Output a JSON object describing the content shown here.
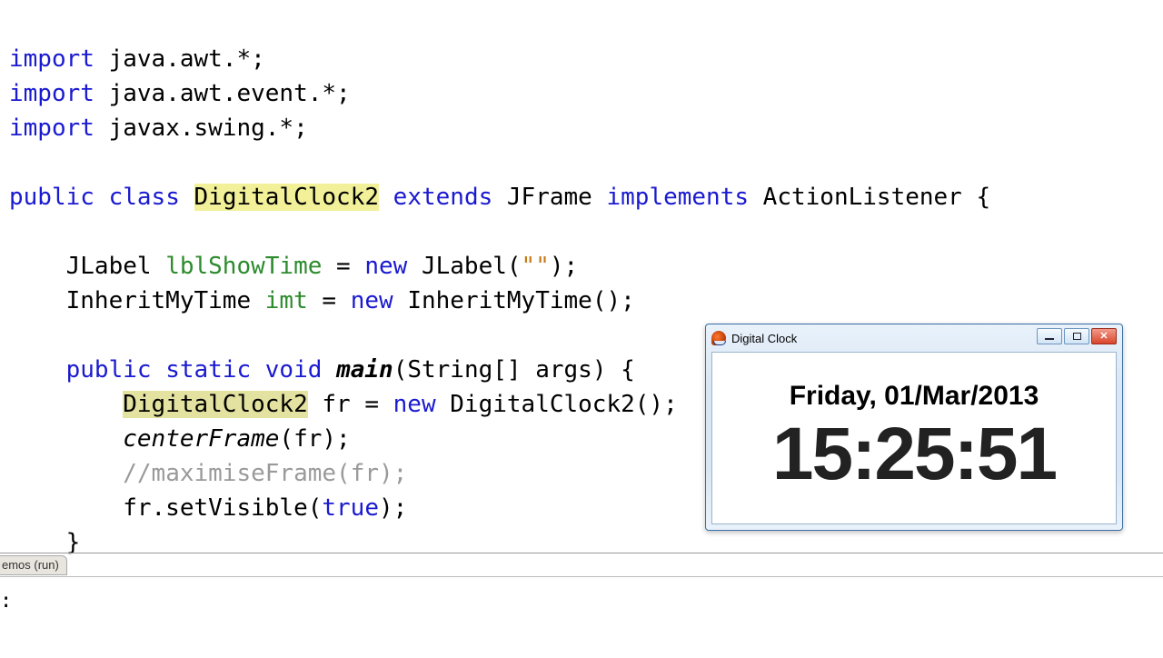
{
  "code": {
    "l1a": "import",
    "l1b": " java.awt.*;",
    "l2a": "import",
    "l2b": " java.awt.event.*;",
    "l3a": "import",
    "l3b": " javax.swing.*;",
    "l5a": "public",
    "l5b": " ",
    "l5c": "class",
    "l5d": " ",
    "l5e": "DigitalClock2",
    "l5f": " ",
    "l5g": "extends",
    "l5h": " JFrame ",
    "l5i": "implements",
    "l5j": " ActionListener {",
    "l7a": "    JLabel ",
    "l7b": "lblShowTime",
    "l7c": " = ",
    "l7d": "new",
    "l7e": " JLabel(",
    "l7f": "\"\"",
    "l7g": ");",
    "l8a": "    InheritMyTime ",
    "l8b": "imt",
    "l8c": " = ",
    "l8d": "new",
    "l8e": " InheritMyTime();",
    "l10a": "    ",
    "l10b": "public",
    "l10c": " ",
    "l10d": "static",
    "l10e": " ",
    "l10f": "void",
    "l10g": " ",
    "l10h": "main",
    "l10i": "(String[] args) {",
    "l11a": "        ",
    "l11b": "DigitalClock2",
    "l11c": " fr = ",
    "l11d": "new",
    "l11e": " DigitalClock2();",
    "l12a": "        ",
    "l12b": "centerFrame",
    "l12c": "(fr);",
    "l13a": "        ",
    "l13b": "//maximiseFrame(fr);",
    "l14a": "        fr.setVisible(",
    "l14b": "true",
    "l14c": ");",
    "l15": "    }"
  },
  "output": {
    "tab": "emos (run)",
    "body": ":"
  },
  "swing": {
    "title": "Digital Clock",
    "date": "Friday, 01/Mar/2013",
    "time": "15:25:51"
  }
}
